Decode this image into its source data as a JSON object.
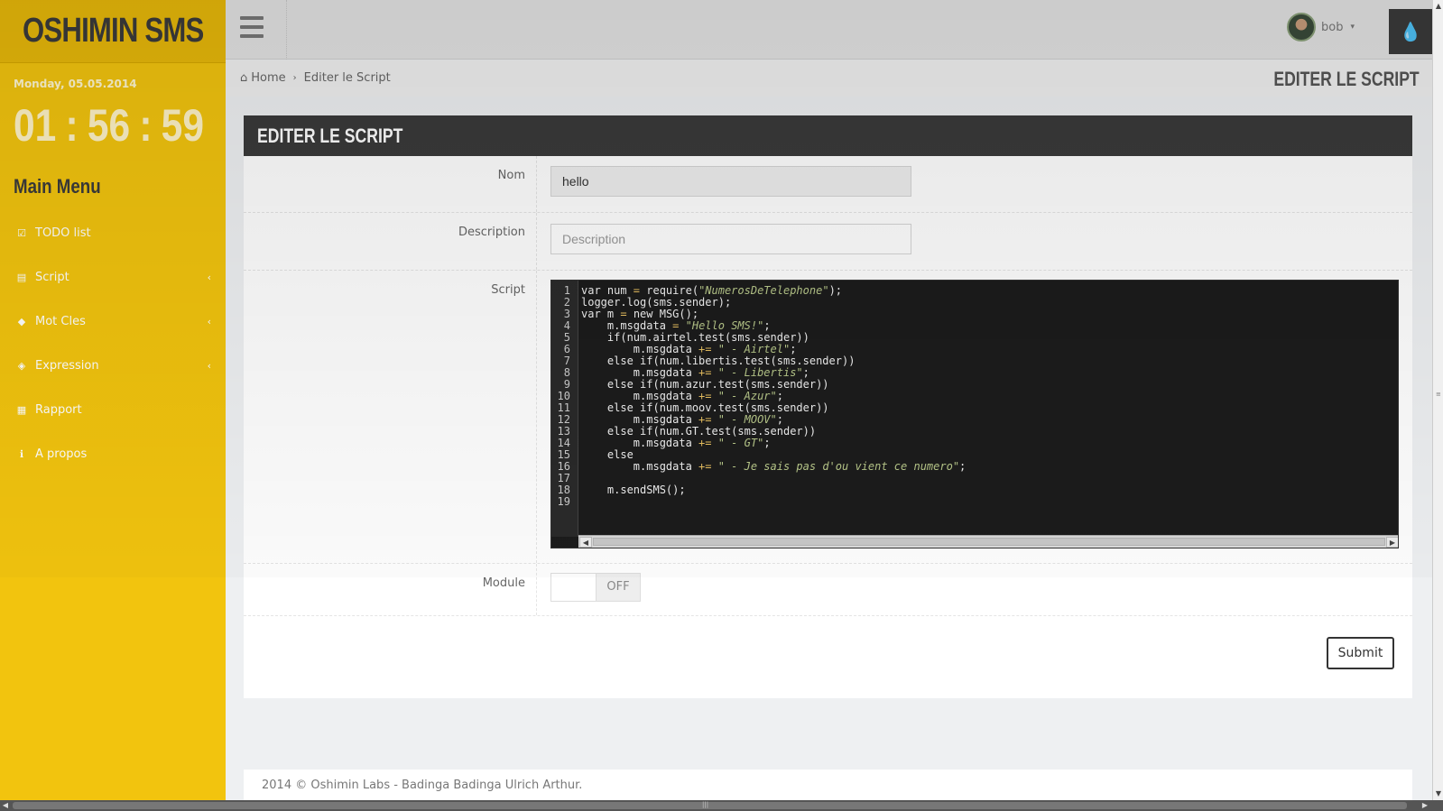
{
  "app": {
    "brand": "OSHIMIN SMS"
  },
  "sidebar": {
    "date": "Monday, 05.05.2014",
    "clock": {
      "hours": "01",
      "minutes": "56",
      "seconds": "59",
      "separator": ":"
    },
    "menu_title": "Main Menu",
    "items": [
      {
        "label": "TODO list",
        "icon": "check-square-icon",
        "icon_glyph": "☑",
        "has_submenu": false
      },
      {
        "label": "Script",
        "icon": "file-icon",
        "icon_glyph": "▤",
        "has_submenu": true
      },
      {
        "label": "Mot Cles",
        "icon": "tags-icon",
        "icon_glyph": "◆",
        "has_submenu": true
      },
      {
        "label": "Expression",
        "icon": "ticket-icon",
        "icon_glyph": "◈",
        "has_submenu": true
      },
      {
        "label": "Rapport",
        "icon": "table-icon",
        "icon_glyph": "▦",
        "has_submenu": false
      },
      {
        "label": "A propos",
        "icon": "info-circle-icon",
        "icon_glyph": "ℹ",
        "has_submenu": false
      }
    ],
    "submenu_glyph": "‹"
  },
  "header": {
    "username": "bob",
    "caret": "▾",
    "theme_icon": "💧"
  },
  "breadcrumb": {
    "home_glyph": "⌂",
    "home": "Home",
    "separator": "›",
    "current": "Editer le Script"
  },
  "page_title": "EDITER LE SCRIPT",
  "panel": {
    "title": "EDITER LE SCRIPT",
    "fields": {
      "nom_label": "Nom",
      "nom_value": "hello",
      "description_label": "Description",
      "description_placeholder": "Description",
      "script_label": "Script",
      "module_label": "Module",
      "module_state": "OFF"
    },
    "submit_label": "Submit"
  },
  "editor": {
    "line_numbers": [
      "1",
      "2",
      "3",
      "4",
      "5",
      "6",
      "7",
      "8",
      "9",
      "10",
      "11",
      "12",
      "13",
      "14",
      "15",
      "16",
      "17",
      "18",
      "19"
    ],
    "lines": [
      [
        [
          "kw",
          "var num "
        ],
        [
          "op",
          "="
        ],
        [
          "kw",
          " require("
        ],
        [
          "str",
          "\"NumerosDeTelephone\""
        ],
        [
          "kw",
          ");"
        ]
      ],
      [
        [
          "kw",
          "logger.log(sms.sender);"
        ]
      ],
      [
        [
          "kw",
          "var m "
        ],
        [
          "op",
          "="
        ],
        [
          "kw",
          " new MSG();"
        ]
      ],
      [
        [
          "kw",
          "    m.msgdata "
        ],
        [
          "op",
          "="
        ],
        [
          "kw",
          " "
        ],
        [
          "str",
          "\"Hello SMS!\""
        ],
        [
          "kw",
          ";"
        ]
      ],
      [
        [
          "kw",
          "    if(num.airtel.test(sms.sender))"
        ]
      ],
      [
        [
          "kw",
          "        m.msgdata "
        ],
        [
          "op",
          "+="
        ],
        [
          "kw",
          " "
        ],
        [
          "str",
          "\" - Airtel\""
        ],
        [
          "kw",
          ";"
        ]
      ],
      [
        [
          "kw",
          "    else if(num.libertis.test(sms.sender))"
        ]
      ],
      [
        [
          "kw",
          "        m.msgdata "
        ],
        [
          "op",
          "+="
        ],
        [
          "kw",
          " "
        ],
        [
          "str",
          "\" - Libertis\""
        ],
        [
          "kw",
          ";"
        ]
      ],
      [
        [
          "kw",
          "    else if(num.azur.test(sms.sender))"
        ]
      ],
      [
        [
          "kw",
          "        m.msgdata "
        ],
        [
          "op",
          "+="
        ],
        [
          "kw",
          " "
        ],
        [
          "str",
          "\" - Azur\""
        ],
        [
          "kw",
          ";"
        ]
      ],
      [
        [
          "kw",
          "    else if(num.moov.test(sms.sender))"
        ]
      ],
      [
        [
          "kw",
          "        m.msgdata "
        ],
        [
          "op",
          "+="
        ],
        [
          "kw",
          " "
        ],
        [
          "str",
          "\" - MOOV\""
        ],
        [
          "kw",
          ";"
        ]
      ],
      [
        [
          "kw",
          "    else if(num.GT.test(sms.sender))"
        ]
      ],
      [
        [
          "kw",
          "        m.msgdata "
        ],
        [
          "op",
          "+="
        ],
        [
          "kw",
          " "
        ],
        [
          "str",
          "\" - GT\""
        ],
        [
          "kw",
          ";"
        ]
      ],
      [
        [
          "kw",
          "    else"
        ]
      ],
      [
        [
          "kw",
          "        m.msgdata "
        ],
        [
          "op",
          "+="
        ],
        [
          "kw",
          " "
        ],
        [
          "str",
          "\" - Je sais pas d'ou vient ce numero\""
        ],
        [
          "kw",
          ";"
        ]
      ],
      [
        [
          "kw",
          ""
        ]
      ],
      [
        [
          "kw",
          "    m.sendSMS();"
        ]
      ],
      [
        [
          "kw",
          ""
        ]
      ]
    ]
  },
  "footer": {
    "text": "2014 © Oshimin Labs - Badinga Badinga Ulrich Arthur."
  },
  "colors": {
    "sidebar": "#f2c40e",
    "panel_header": "#3a3a3a",
    "editor_bg": "#1c1c1c",
    "string": "#b8c88a",
    "operator": "#e8c060"
  }
}
